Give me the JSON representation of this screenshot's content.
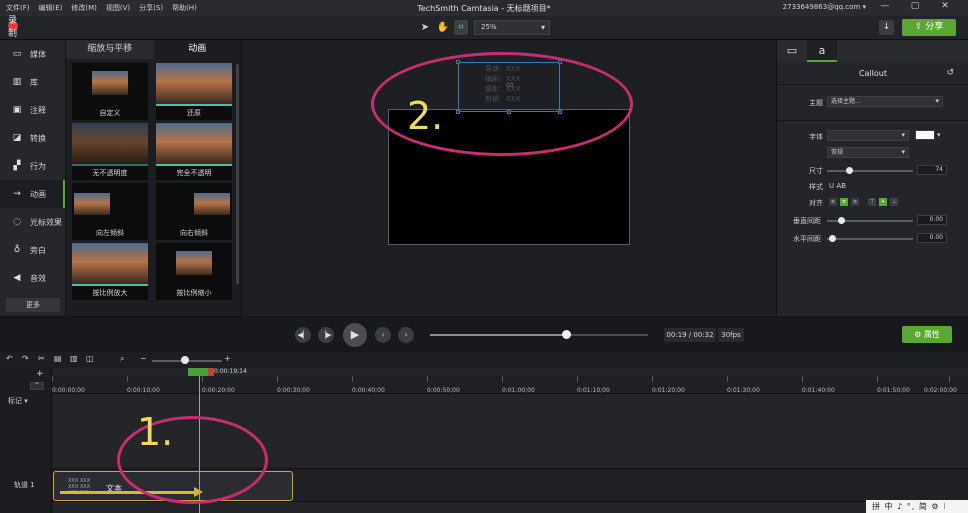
{
  "titlebar": {
    "menu": [
      "文件(F)",
      "编辑(E)",
      "修改(M)",
      "视图(V)",
      "分享(S)",
      "帮助(H)"
    ],
    "title": "TechSmith Camtasia - 无标题项目*",
    "account": "2733649863@qq.com ▾",
    "window_buttons": [
      "—",
      "▢",
      "✕"
    ]
  },
  "toolbar": {
    "record_label": "录制",
    "zoom": "25%",
    "share_label": "分享",
    "download_icon": "↓"
  },
  "leftnav": {
    "items": [
      {
        "label": "媒体",
        "icon": "media-icon"
      },
      {
        "label": "库",
        "icon": "library-icon"
      },
      {
        "label": "注释",
        "icon": "annotation-icon"
      },
      {
        "label": "转换",
        "icon": "transition-icon"
      },
      {
        "label": "行为",
        "icon": "behavior-icon"
      },
      {
        "label": "动画",
        "icon": "animation-icon"
      },
      {
        "label": "光标效果",
        "icon": "cursor-icon"
      },
      {
        "label": "旁白",
        "icon": "mic-icon"
      },
      {
        "label": "音效",
        "icon": "audio-icon"
      }
    ],
    "more": "更多"
  },
  "animpanel": {
    "tabs": [
      "缩放与平移",
      "动画"
    ],
    "tiles": [
      "自定义",
      "还原",
      "无不透明度",
      "完全不透明",
      "向左倾斜",
      "向右倾斜",
      "按比例放大",
      "按比例缩小"
    ]
  },
  "canvas": {
    "callout_lines": [
      "导演：XXX",
      "编剧：XXX",
      "摄影：XXX",
      "剪辑：XXX"
    ],
    "callout_center": "00"
  },
  "props": {
    "title": "Callout",
    "theme_label": "主题",
    "theme_value": "选择主题...",
    "font_label": "字体",
    "font_value": "",
    "weight_value": "常规",
    "size_label": "尺寸",
    "size_value": "74",
    "style_label": "样式",
    "style_glyphs": "U  AB",
    "align_label": "对齐",
    "vspacing_label": "垂直间距",
    "vspacing_value": "0.00",
    "hspacing_label": "水平间距",
    "hspacing_value": "0.00"
  },
  "playback": {
    "time": "00:19 / 00:32",
    "fps": "30fps",
    "properties_label": "属性"
  },
  "timeline": {
    "playhead_time": "0:00:19;14",
    "ruler": [
      "0:00:00;00",
      "0:00:10;00",
      "0:00:20;00",
      "0:00:30;00",
      "0:00:40;00",
      "0:00:50;00",
      "0:01:00;00",
      "0:01:10;00",
      "0:01:20;00",
      "0:01:30;00",
      "0:01:40;00",
      "0:01:50;00",
      "0:02:00;00"
    ],
    "marker_label": "标记",
    "track_label": "轨道 1",
    "clip_label": "文本",
    "clip_small": [
      "XXX  XXX",
      "XXX  XXX",
      "XXX  XXX"
    ]
  },
  "annotations": {
    "one": "1.",
    "two": "2."
  },
  "ime": "拼 中 ♪ °, 简 ⚙ ⁝",
  "colors": {
    "accent_green": "#5aa832",
    "annotation_pink": "#c72d70",
    "annotation_yellow": "#f0dc55"
  }
}
